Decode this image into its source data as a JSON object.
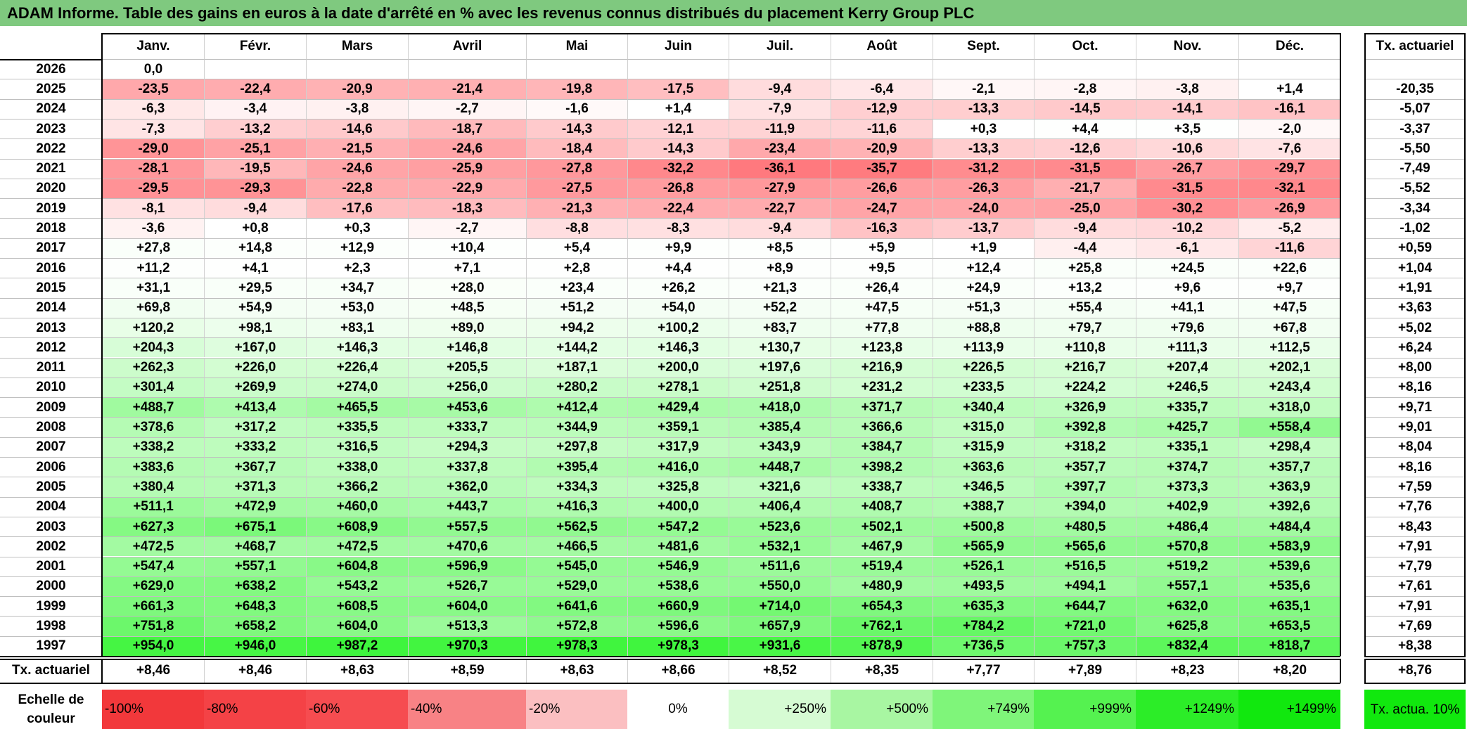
{
  "title": "ADAM Informe. Table des gains en euros à la date d'arrêté en % avec les revenus connus distribués du placement Kerry Group PLC",
  "chart_data": {
    "type": "table",
    "months": [
      "Janv.",
      "Févr.",
      "Mars",
      "Avril",
      "Mai",
      "Juin",
      "Juil.",
      "Août",
      "Sept.",
      "Oct.",
      "Nov.",
      "Déc."
    ],
    "rate_header": "Tx. actuariel",
    "rows": [
      {
        "year": "2026",
        "values": [
          "0,0",
          "",
          "",
          "",
          "",
          "",
          "",
          "",
          "",
          "",
          "",
          ""
        ],
        "rate": ""
      },
      {
        "year": "2025",
        "values": [
          "-23,5",
          "-22,4",
          "-20,9",
          "-21,4",
          "-19,8",
          "-17,5",
          "-9,4",
          "-6,4",
          "-2,1",
          "-2,8",
          "-3,8",
          "+1,4"
        ],
        "rate": "-20,35"
      },
      {
        "year": "2024",
        "values": [
          "-6,3",
          "-3,4",
          "-3,8",
          "-2,7",
          "-1,6",
          "+1,4",
          "-7,9",
          "-12,9",
          "-13,3",
          "-14,5",
          "-14,1",
          "-16,1"
        ],
        "rate": "-5,07"
      },
      {
        "year": "2023",
        "values": [
          "-7,3",
          "-13,2",
          "-14,6",
          "-18,7",
          "-14,3",
          "-12,1",
          "-11,9",
          "-11,6",
          "+0,3",
          "+4,4",
          "+3,5",
          "-2,0"
        ],
        "rate": "-3,37"
      },
      {
        "year": "2022",
        "values": [
          "-29,0",
          "-25,1",
          "-21,5",
          "-24,6",
          "-18,4",
          "-14,3",
          "-23,4",
          "-20,9",
          "-13,3",
          "-12,6",
          "-10,6",
          "-7,6"
        ],
        "rate": "-5,50"
      },
      {
        "year": "2021",
        "values": [
          "-28,1",
          "-19,5",
          "-24,6",
          "-25,9",
          "-27,8",
          "-32,2",
          "-36,1",
          "-35,7",
          "-31,2",
          "-31,5",
          "-26,7",
          "-29,7"
        ],
        "rate": "-7,49"
      },
      {
        "year": "2020",
        "values": [
          "-29,5",
          "-29,3",
          "-22,8",
          "-22,9",
          "-27,5",
          "-26,8",
          "-27,9",
          "-26,6",
          "-26,3",
          "-21,7",
          "-31,5",
          "-32,1"
        ],
        "rate": "-5,52"
      },
      {
        "year": "2019",
        "values": [
          "-8,1",
          "-9,4",
          "-17,6",
          "-18,3",
          "-21,3",
          "-22,4",
          "-22,7",
          "-24,7",
          "-24,0",
          "-25,0",
          "-30,2",
          "-26,9"
        ],
        "rate": "-3,34"
      },
      {
        "year": "2018",
        "values": [
          "-3,6",
          "+0,8",
          "+0,3",
          "-2,7",
          "-8,8",
          "-8,3",
          "-9,4",
          "-16,3",
          "-13,7",
          "-9,4",
          "-10,2",
          "-5,2"
        ],
        "rate": "-1,02"
      },
      {
        "year": "2017",
        "values": [
          "+27,8",
          "+14,8",
          "+12,9",
          "+10,4",
          "+5,4",
          "+9,9",
          "+8,5",
          "+5,9",
          "+1,9",
          "-4,4",
          "-6,1",
          "-11,6"
        ],
        "rate": "+0,59"
      },
      {
        "year": "2016",
        "values": [
          "+11,2",
          "+4,1",
          "+2,3",
          "+7,1",
          "+2,8",
          "+4,4",
          "+8,9",
          "+9,5",
          "+12,4",
          "+25,8",
          "+24,5",
          "+22,6"
        ],
        "rate": "+1,04"
      },
      {
        "year": "2015",
        "values": [
          "+31,1",
          "+29,5",
          "+34,7",
          "+28,0",
          "+23,4",
          "+26,2",
          "+21,3",
          "+26,4",
          "+24,9",
          "+13,2",
          "+9,6",
          "+9,7"
        ],
        "rate": "+1,91"
      },
      {
        "year": "2014",
        "values": [
          "+69,8",
          "+54,9",
          "+53,0",
          "+48,5",
          "+51,2",
          "+54,0",
          "+52,2",
          "+47,5",
          "+51,3",
          "+55,4",
          "+41,1",
          "+47,5"
        ],
        "rate": "+3,63"
      },
      {
        "year": "2013",
        "values": [
          "+120,2",
          "+98,1",
          "+83,1",
          "+89,0",
          "+94,2",
          "+100,2",
          "+83,7",
          "+77,8",
          "+88,8",
          "+79,7",
          "+79,6",
          "+67,8"
        ],
        "rate": "+5,02"
      },
      {
        "year": "2012",
        "values": [
          "+204,3",
          "+167,0",
          "+146,3",
          "+146,8",
          "+144,2",
          "+146,3",
          "+130,7",
          "+123,8",
          "+113,9",
          "+110,8",
          "+111,3",
          "+112,5"
        ],
        "rate": "+6,24"
      },
      {
        "year": "2011",
        "values": [
          "+262,3",
          "+226,0",
          "+226,4",
          "+205,5",
          "+187,1",
          "+200,0",
          "+197,6",
          "+216,9",
          "+226,5",
          "+216,7",
          "+207,4",
          "+202,1"
        ],
        "rate": "+8,00"
      },
      {
        "year": "2010",
        "values": [
          "+301,4",
          "+269,9",
          "+274,0",
          "+256,0",
          "+280,2",
          "+278,1",
          "+251,8",
          "+231,2",
          "+233,5",
          "+224,2",
          "+246,5",
          "+243,4"
        ],
        "rate": "+8,16"
      },
      {
        "year": "2009",
        "values": [
          "+488,7",
          "+413,4",
          "+465,5",
          "+453,6",
          "+412,4",
          "+429,4",
          "+418,0",
          "+371,7",
          "+340,4",
          "+326,9",
          "+335,7",
          "+318,0"
        ],
        "rate": "+9,71"
      },
      {
        "year": "2008",
        "values": [
          "+378,6",
          "+317,2",
          "+335,5",
          "+333,7",
          "+344,9",
          "+359,1",
          "+385,4",
          "+366,6",
          "+315,0",
          "+392,8",
          "+425,7",
          "+558,4"
        ],
        "rate": "+9,01"
      },
      {
        "year": "2007",
        "values": [
          "+338,2",
          "+333,2",
          "+316,5",
          "+294,3",
          "+297,8",
          "+317,9",
          "+343,9",
          "+384,7",
          "+315,9",
          "+318,2",
          "+335,1",
          "+298,4"
        ],
        "rate": "+8,04"
      },
      {
        "year": "2006",
        "values": [
          "+383,6",
          "+367,7",
          "+338,0",
          "+337,8",
          "+395,4",
          "+416,0",
          "+448,7",
          "+398,2",
          "+363,6",
          "+357,7",
          "+374,7",
          "+357,7"
        ],
        "rate": "+8,16"
      },
      {
        "year": "2005",
        "values": [
          "+380,4",
          "+371,3",
          "+366,2",
          "+362,0",
          "+334,3",
          "+325,8",
          "+321,6",
          "+338,7",
          "+346,5",
          "+397,7",
          "+373,3",
          "+363,9"
        ],
        "rate": "+7,59"
      },
      {
        "year": "2004",
        "values": [
          "+511,1",
          "+472,9",
          "+460,0",
          "+443,7",
          "+416,3",
          "+400,0",
          "+406,4",
          "+408,7",
          "+388,7",
          "+394,0",
          "+402,9",
          "+392,6"
        ],
        "rate": "+7,76"
      },
      {
        "year": "2003",
        "values": [
          "+627,3",
          "+675,1",
          "+608,9",
          "+557,5",
          "+562,5",
          "+547,2",
          "+523,6",
          "+502,1",
          "+500,8",
          "+480,5",
          "+486,4",
          "+484,4"
        ],
        "rate": "+8,43"
      },
      {
        "year": "2002",
        "values": [
          "+472,5",
          "+468,7",
          "+472,5",
          "+470,6",
          "+466,5",
          "+481,6",
          "+532,1",
          "+467,9",
          "+565,9",
          "+565,6",
          "+570,8",
          "+583,9"
        ],
        "rate": "+7,91"
      },
      {
        "year": "2001",
        "values": [
          "+547,4",
          "+557,1",
          "+604,8",
          "+596,9",
          "+545,0",
          "+546,9",
          "+511,6",
          "+519,4",
          "+526,1",
          "+516,5",
          "+519,2",
          "+539,6"
        ],
        "rate": "+7,79"
      },
      {
        "year": "2000",
        "values": [
          "+629,0",
          "+638,2",
          "+543,2",
          "+526,7",
          "+529,0",
          "+538,6",
          "+550,0",
          "+480,9",
          "+493,5",
          "+494,1",
          "+557,1",
          "+535,6"
        ],
        "rate": "+7,61"
      },
      {
        "year": "1999",
        "values": [
          "+661,3",
          "+648,3",
          "+608,5",
          "+604,0",
          "+641,6",
          "+660,9",
          "+714,0",
          "+654,3",
          "+635,3",
          "+644,7",
          "+632,0",
          "+635,1"
        ],
        "rate": "+7,91"
      },
      {
        "year": "1998",
        "values": [
          "+751,8",
          "+658,2",
          "+604,0",
          "+513,3",
          "+572,8",
          "+596,6",
          "+657,9",
          "+762,1",
          "+784,2",
          "+721,0",
          "+625,8",
          "+653,5"
        ],
        "rate": "+7,69"
      },
      {
        "year": "1997",
        "values": [
          "+954,0",
          "+946,0",
          "+987,2",
          "+970,3",
          "+978,3",
          "+978,3",
          "+931,6",
          "+878,9",
          "+736,5",
          "+757,3",
          "+832,4",
          "+818,7"
        ],
        "rate": "+8,38"
      }
    ],
    "summary_row": {
      "label": "Tx. actuariel",
      "values": [
        "+8,46",
        "+8,46",
        "+8,63",
        "+8,59",
        "+8,63",
        "+8,66",
        "+8,52",
        "+8,35",
        "+7,77",
        "+7,89",
        "+8,23",
        "+8,20"
      ],
      "total": "+8,76"
    },
    "legend": {
      "label": "Echelle de couleur",
      "items": [
        {
          "label": "-100%",
          "color": "#f2383b"
        },
        {
          "label": "-80%",
          "color": "#f44246"
        },
        {
          "label": "-60%",
          "color": "#f64c50"
        },
        {
          "label": "-40%",
          "color": "#f88285"
        },
        {
          "label": "-20%",
          "color": "#fbbfc1"
        },
        {
          "label": "0%",
          "color": "#ffffff"
        },
        {
          "label": "+250%",
          "color": "#d6fbd3"
        },
        {
          "label": "+500%",
          "color": "#a8f6a2"
        },
        {
          "label": "+749%",
          "color": "#7ff57a"
        },
        {
          "label": "+999%",
          "color": "#55f250"
        },
        {
          "label": "+1249%",
          "color": "#2ced28"
        },
        {
          "label": "+1499%",
          "color": "#11e80e"
        }
      ],
      "rate_label": "Tx. actua. 10%",
      "rate_color": "#11e80e"
    }
  }
}
